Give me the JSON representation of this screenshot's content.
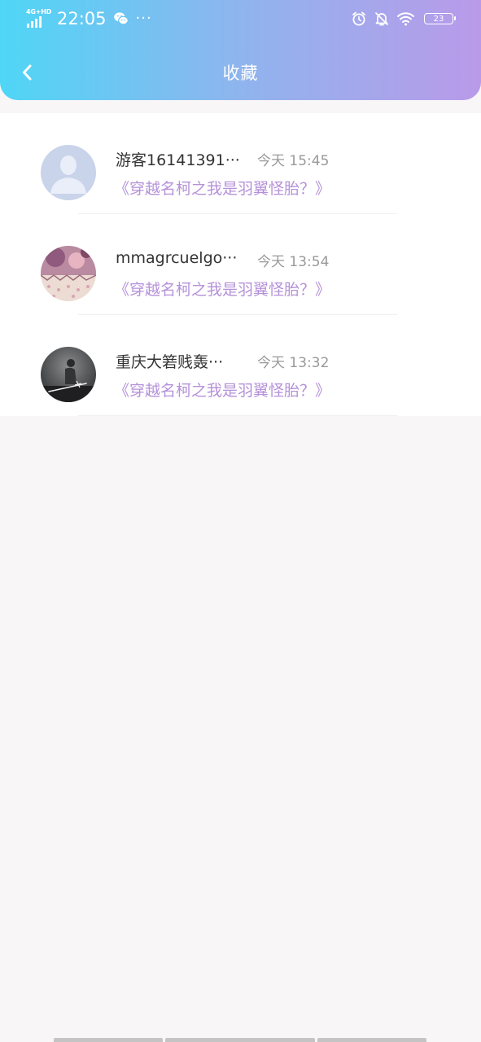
{
  "status_bar": {
    "network": "4G+HD",
    "time": "22:05",
    "more": "···",
    "battery": "23",
    "icons": [
      "signal-icon",
      "wechat-icon",
      "alarm-icon",
      "bell-off-icon",
      "wifi-icon",
      "battery-icon"
    ]
  },
  "header": {
    "title": "收藏",
    "back_icon": "chevron-left-icon"
  },
  "items": [
    {
      "username": "游客16141391···",
      "time": "今天 15:45",
      "book": "《穿越名柯之我是羽翼怪胎？》",
      "avatar": "default-user-avatar"
    },
    {
      "username": "mmagrcuelgo···",
      "time": "今天 13:54",
      "book": "《穿越名柯之我是羽翼怪胎？》",
      "avatar": "photo-avatar"
    },
    {
      "username": "重庆大箬贱轰···",
      "time": "今天 13:32",
      "book": "《穿越名柯之我是羽翼怪胎？》",
      "avatar": "photo-avatar"
    }
  ],
  "colors": {
    "header_gradient_start": "#4fd6f6",
    "header_gradient_end": "#b99ae9",
    "book_title": "#b591d9",
    "timestamp": "#999999",
    "background": "#f8f6f7"
  }
}
